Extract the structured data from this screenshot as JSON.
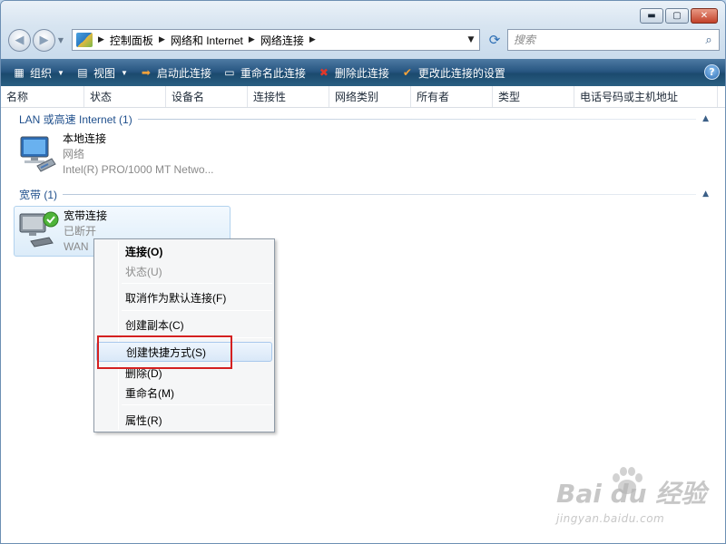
{
  "window": {
    "caption_buttons": [
      {
        "name": "minimize",
        "glyph": "▬"
      },
      {
        "name": "maximize",
        "glyph": "▢"
      },
      {
        "name": "close",
        "glyph": "✕"
      }
    ]
  },
  "nav": {
    "back_glyph": "◀",
    "forward_glyph": "▶",
    "recent_glyph": "▼",
    "breadcrumbs": [
      "控制面板",
      "网络和 Internet",
      "网络连接"
    ],
    "refresh_glyph": "⟳",
    "search_placeholder": "搜索",
    "search_icon": "search-icon"
  },
  "toolbar": {
    "buttons": [
      {
        "id": "organize",
        "label": "组织",
        "icon": "organize-icon",
        "glyph": "▦",
        "has_caret": true
      },
      {
        "id": "views",
        "label": "视图",
        "icon": "views-icon",
        "glyph": "▤",
        "has_caret": true
      },
      {
        "id": "start",
        "label": "启动此连接",
        "icon": "start-icon",
        "glyph": "➡",
        "has_caret": false
      },
      {
        "id": "rename",
        "label": "重命名此连接",
        "icon": "rename-icon",
        "glyph": "▭",
        "has_caret": false
      },
      {
        "id": "delete",
        "label": "删除此连接",
        "icon": "delete-icon",
        "glyph": "✖",
        "has_caret": false
      },
      {
        "id": "change",
        "label": "更改此连接的设置",
        "icon": "check-icon",
        "glyph": "✔",
        "has_caret": false
      }
    ],
    "caret_glyph": "▼",
    "help_label": "?"
  },
  "columns": [
    "名称",
    "状态",
    "设备名",
    "连接性",
    "网络类别",
    "所有者",
    "类型",
    "电话号码或主机地址"
  ],
  "groups": [
    {
      "title": "LAN 或高速 Internet (1)",
      "collapse_glyph": "▲",
      "items": [
        {
          "name": "本地连接",
          "status": "网络",
          "device": "Intel(R) PRO/1000 MT Netwo...",
          "selected": false
        }
      ]
    },
    {
      "title": "宽带 (1)",
      "collapse_glyph": "▲",
      "items": [
        {
          "name": "宽带连接",
          "status": "已断开",
          "device": "WAN",
          "selected": true
        }
      ]
    }
  ],
  "context_menu": {
    "items": [
      {
        "label": "连接(O)",
        "style": "bold"
      },
      {
        "label": "状态(U)",
        "style": "disabled"
      },
      {
        "label": "取消作为默认连接(F)",
        "style": "normal"
      },
      {
        "label": "创建副本(C)",
        "style": "normal"
      },
      {
        "label": "创建快捷方式(S)",
        "style": "hover"
      },
      {
        "label": "删除(D)",
        "style": "normal"
      },
      {
        "label": "重命名(M)",
        "style": "normal"
      },
      {
        "label": "属性(R)",
        "style": "normal"
      }
    ]
  },
  "watermark": {
    "main": "Bai du 经验",
    "sub": "jingyan.baidu.com"
  },
  "colors": {
    "toolbar": "#285782",
    "highlight": "#d42020",
    "group_title": "#1f4f8c"
  }
}
